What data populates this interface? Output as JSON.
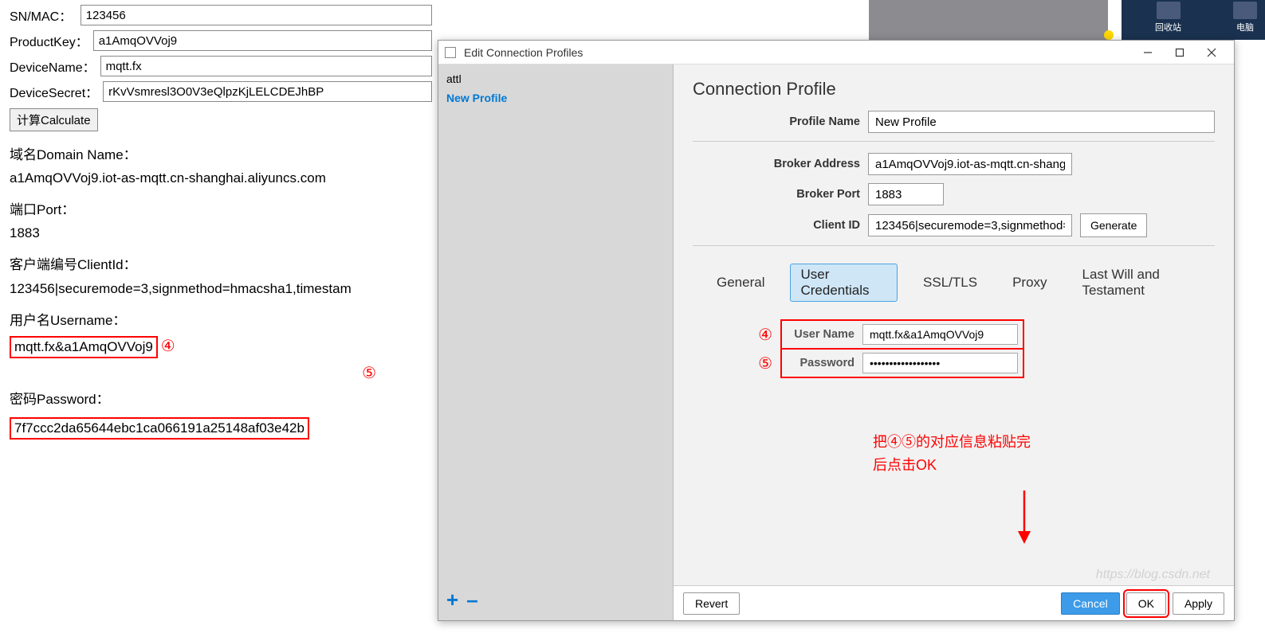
{
  "left": {
    "sn_label": "SN/MAC：",
    "sn_value": "123456",
    "pk_label": "ProductKey：",
    "pk_value": "a1AmqOVVoj9",
    "dn_label": "DeviceName：",
    "dn_value": "mqtt.fx",
    "ds_label": "DeviceSecret：",
    "ds_value": "rKvVsmresl3O0V3eQlpzKjLELCDEJhBP",
    "calc_btn": "计算Calculate",
    "domain_label": "域名Domain Name：",
    "domain_value": "a1AmqOVVoj9.iot-as-mqtt.cn-shanghai.aliyuncs.com",
    "port_label": "端口Port：",
    "port_value": "1883",
    "clientid_label": "客户端编号ClientId：",
    "clientid_value": "123456|securemode=3,signmethod=hmacsha1,timestam",
    "username_label": "用户名Username：",
    "username_value": "mqtt.fx&a1AmqOVVoj9",
    "password_label": "密码Password：",
    "password_value": "7f7ccc2da65644ebc1ca066191a25148af03e42b",
    "mark4": "④",
    "mark5": "⑤"
  },
  "desktop": {
    "recycle": "回收站",
    "computer": "电脑"
  },
  "dialog": {
    "title": "Edit Connection Profiles",
    "sidebar": {
      "item0": "attl",
      "item1": "New Profile",
      "add": "+",
      "remove": "–"
    },
    "win": {
      "min": "—",
      "max": "☐",
      "close": "✕"
    },
    "main": {
      "heading": "Connection Profile",
      "profile_name_label": "Profile Name",
      "profile_name_value": "New Profile",
      "broker_addr_label": "Broker Address",
      "broker_addr_value": "a1AmqOVVoj9.iot-as-mqtt.cn-shang",
      "broker_port_label": "Broker Port",
      "broker_port_value": "1883",
      "client_id_label": "Client ID",
      "client_id_value": "123456|securemode=3,signmethod=",
      "generate_btn": "Generate",
      "tabs": {
        "general": "General",
        "user_cred": "User Credentials",
        "ssl": "SSL/TLS",
        "proxy": "Proxy",
        "lwt": "Last Will and Testament"
      },
      "username_label": "User Name",
      "username_value": "mqtt.fx&a1AmqOVVoj9",
      "password_label": "Password",
      "password_value": "••••••••••••••••••",
      "note_line1": "把④⑤的对应信息粘贴完",
      "note_line2": "后点击OK",
      "mark4": "④",
      "mark5": "⑤"
    },
    "buttons": {
      "revert": "Revert",
      "cancel": "Cancel",
      "ok": "OK",
      "apply": "Apply"
    },
    "watermark": "https://blog.csdn.net"
  }
}
